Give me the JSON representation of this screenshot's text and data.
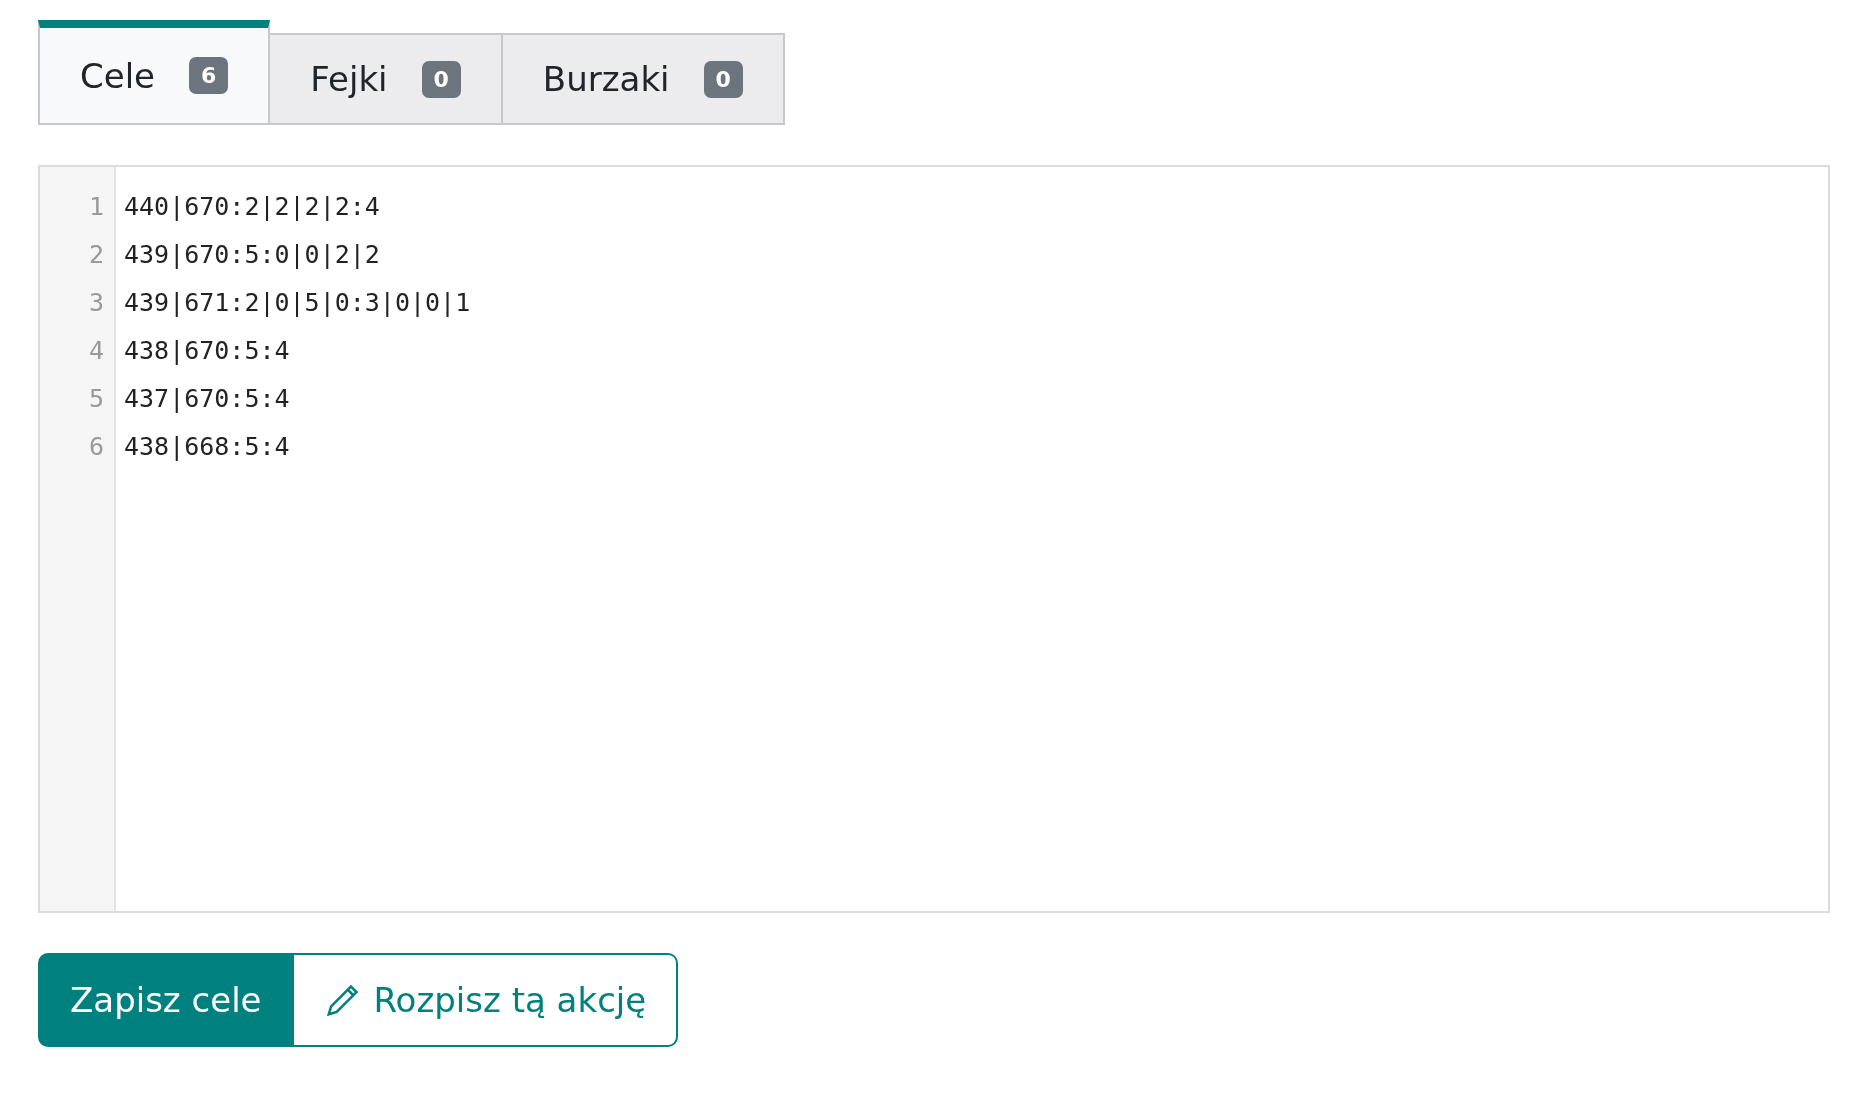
{
  "tabs": [
    {
      "label": "Cele",
      "count": "6",
      "selected": true
    },
    {
      "label": "Fejki",
      "count": "0",
      "selected": false
    },
    {
      "label": "Burzaki",
      "count": "0",
      "selected": false
    }
  ],
  "editor": {
    "lines": [
      {
        "number": "1",
        "text": "440|670:2|2|2|2:4"
      },
      {
        "number": "2",
        "text": "439|670:5:0|0|2|2"
      },
      {
        "number": "3",
        "text": "439|671:2|0|5|0:3|0|0|1"
      },
      {
        "number": "4",
        "text": "438|670:5:4"
      },
      {
        "number": "5",
        "text": "437|670:5:4"
      },
      {
        "number": "6",
        "text": "438|668:5:4"
      }
    ]
  },
  "buttons": [
    {
      "kind": "primary",
      "label": "Zapisz cele"
    },
    {
      "kind": "outline",
      "label": "Rozpisz tą akcję"
    }
  ]
}
